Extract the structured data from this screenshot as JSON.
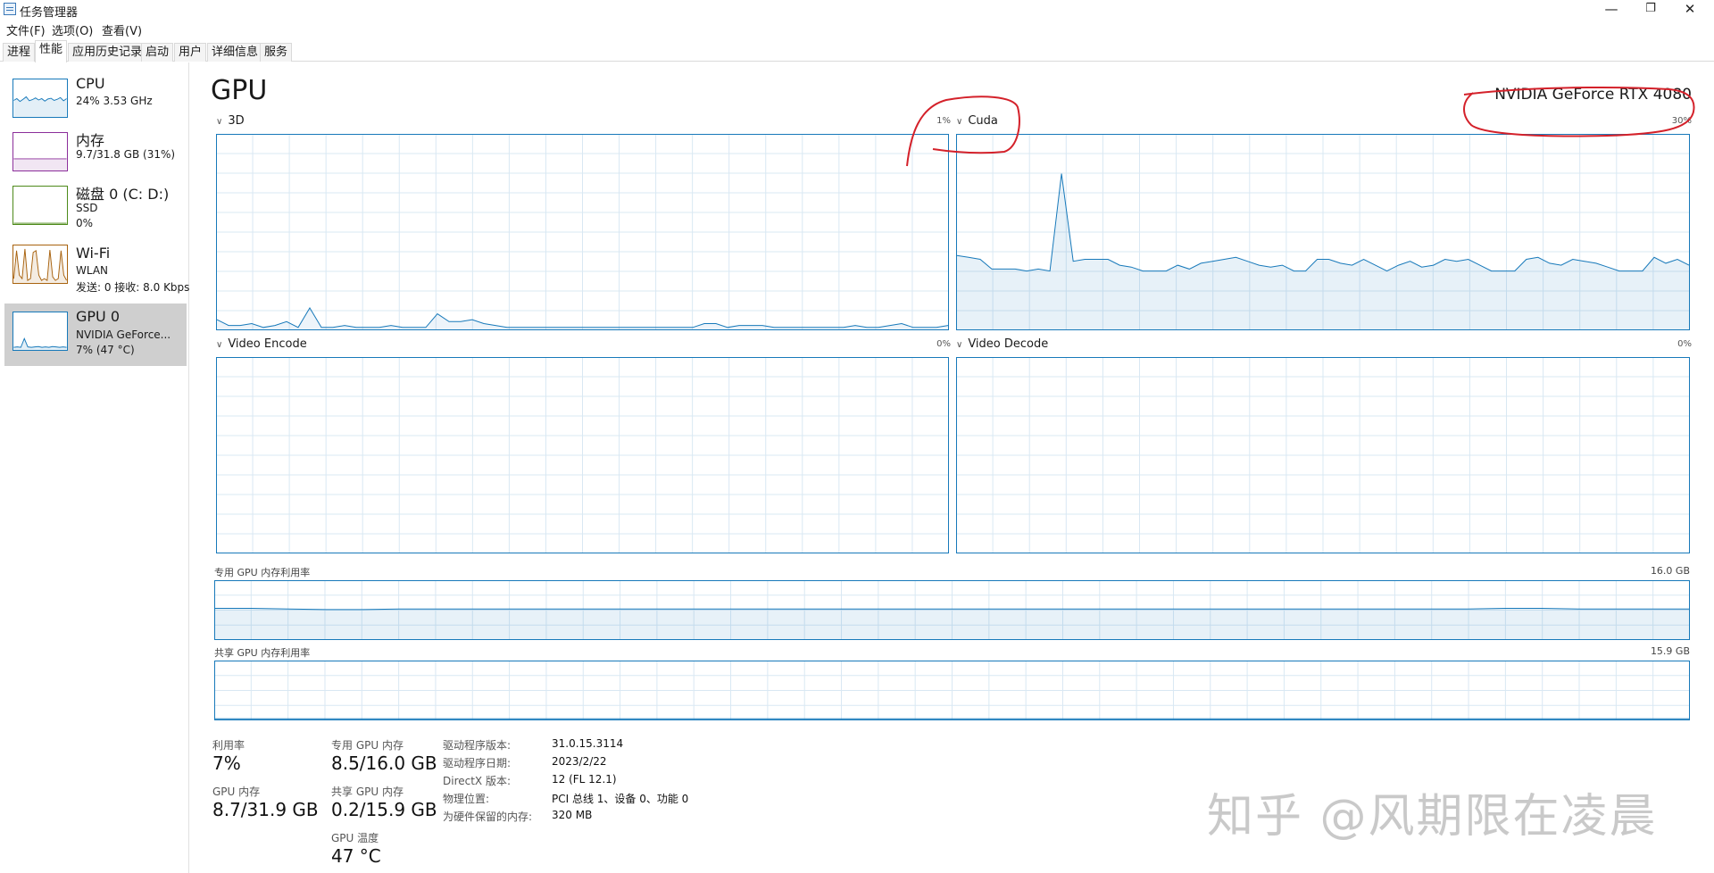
{
  "window": {
    "title": "任务管理器",
    "controls": {
      "minimize": "—",
      "restore": "❐",
      "close": "✕"
    }
  },
  "menu": [
    "文件(F)",
    "选项(O)",
    "查看(V)"
  ],
  "tabs": [
    "进程",
    "性能",
    "应用历史记录",
    "启动",
    "用户",
    "详细信息",
    "服务"
  ],
  "sidebar": [
    {
      "title": "CPU",
      "line1": "24%  3.53 GHz",
      "line2": "",
      "color": "#1779ba"
    },
    {
      "title": "内存",
      "line1": "9.7/31.8 GB (31%)",
      "line2": "",
      "color": "#8b2e9a"
    },
    {
      "title": "磁盘 0 (C: D:)",
      "line1": "SSD",
      "line2": "0%",
      "color": "#4d8a1a"
    },
    {
      "title": "Wi-Fi",
      "line1": "WLAN",
      "line2": "发送: 0  接收: 8.0 Kbps",
      "color": "#a8620e"
    },
    {
      "title": "GPU 0",
      "line1": "NVIDIA GeForce...",
      "line2": "7% (47 °C)",
      "color": "#1779ba"
    }
  ],
  "main": {
    "title": "GPU",
    "gpu_name": "NVIDIA GeForce RTX 4080",
    "engines": [
      {
        "name": "3D",
        "percent": "1%"
      },
      {
        "name": "Cuda",
        "percent": "30%"
      },
      {
        "name": "Video Encode",
        "percent": "0%"
      },
      {
        "name": "Video Decode",
        "percent": "0%"
      }
    ],
    "dedicated_mem": {
      "label": "专用 GPU 内存利用率",
      "max": "16.0 GB"
    },
    "shared_mem": {
      "label": "共享 GPU 内存利用率",
      "max": "15.9 GB"
    }
  },
  "stats": {
    "utilization_label": "利用率",
    "utilization_value": "7%",
    "gpu_mem_label": "GPU 内存",
    "gpu_mem_value": "8.7/31.9 GB",
    "dedicated_label": "专用 GPU 内存",
    "dedicated_value": "8.5/16.0 GB",
    "shared_label": "共享 GPU 内存",
    "shared_value": "0.2/15.9 GB",
    "temp_label": "GPU 温度",
    "temp_value": "47 °C"
  },
  "info": [
    {
      "key": "驱动程序版本:",
      "value": "31.0.15.3114"
    },
    {
      "key": "驱动程序日期:",
      "value": "2023/2/22"
    },
    {
      "key": "DirectX 版本:",
      "value": "12 (FL 12.1)"
    },
    {
      "key": "物理位置:",
      "value": "PCI 总线 1、设备 0、功能 0"
    },
    {
      "key": "为硬件保留的内存:",
      "value": "320 MB"
    }
  ],
  "watermark": "知乎 @风期限在凌晨",
  "series": {
    "cpu_thumb": [
      0.45,
      0.5,
      0.42,
      0.48,
      0.55,
      0.44,
      0.47,
      0.52,
      0.46,
      0.5,
      0.43,
      0.49,
      0.51,
      0.45,
      0.48,
      0.53,
      0.44,
      0.5
    ],
    "mem_thumb": [
      0.31,
      0.31,
      0.31,
      0.31,
      0.31,
      0.31,
      0.31,
      0.31,
      0.31,
      0.31
    ],
    "disk_thumb": [
      0,
      0,
      0,
      0,
      0,
      0,
      0,
      0,
      0,
      0
    ],
    "wifi_thumb": [
      0.1,
      0.9,
      0.2,
      0.1,
      0.95,
      0.05,
      0.1,
      0.85,
      0.9,
      0.2,
      0.05,
      0.1,
      0.05,
      0.92,
      0.15,
      0.05,
      0.1,
      0.9,
      0.2,
      0.05
    ],
    "gpu_thumb": [
      0.05,
      0.06,
      0.05,
      0.3,
      0.06,
      0.05,
      0.06,
      0.07,
      0.05,
      0.06,
      0.05,
      0.07,
      0.06,
      0.05,
      0.06,
      0.05
    ],
    "engine_3d": [
      5,
      2,
      2,
      3,
      1,
      2,
      4,
      1,
      11,
      1,
      1,
      2,
      1,
      1,
      1,
      2,
      1,
      1,
      1,
      8,
      4,
      4,
      5,
      3,
      2,
      1,
      1,
      1,
      1,
      1,
      1,
      1,
      1,
      1,
      1,
      1,
      1,
      1,
      1,
      1,
      1,
      1,
      3,
      3,
      1,
      2,
      2,
      2,
      1,
      1,
      1,
      1,
      1,
      1,
      1,
      2,
      1,
      1,
      2,
      3,
      1,
      1,
      1,
      2
    ],
    "engine_cuda": [
      38,
      37,
      36,
      31,
      31,
      31,
      30,
      31,
      30,
      80,
      35,
      36,
      36,
      36,
      33,
      32,
      30,
      30,
      30,
      33,
      31,
      34,
      35,
      36,
      37,
      35,
      33,
      32,
      33,
      30,
      30,
      36,
      36,
      34,
      33,
      36,
      33,
      30,
      33,
      35,
      32,
      33,
      36,
      35,
      36,
      33,
      30,
      30,
      30,
      36,
      37,
      34,
      33,
      36,
      35,
      34,
      32,
      30,
      30,
      30,
      37,
      34,
      36,
      33
    ],
    "dedicated_mem": [
      53,
      53,
      52,
      51,
      51,
      52,
      52,
      52,
      52,
      52,
      52,
      52,
      52,
      52,
      52,
      52,
      52,
      52,
      52,
      52,
      52,
      52,
      52,
      52,
      52,
      52,
      52,
      52,
      52,
      52,
      52,
      52,
      52,
      52,
      52,
      53,
      53,
      52,
      52,
      52,
      52
    ],
    "shared_mem": [
      1,
      1,
      1,
      1,
      1,
      1,
      1,
      1,
      1,
      1,
      1,
      1,
      1,
      1,
      1,
      1,
      1,
      1,
      1,
      1
    ]
  }
}
